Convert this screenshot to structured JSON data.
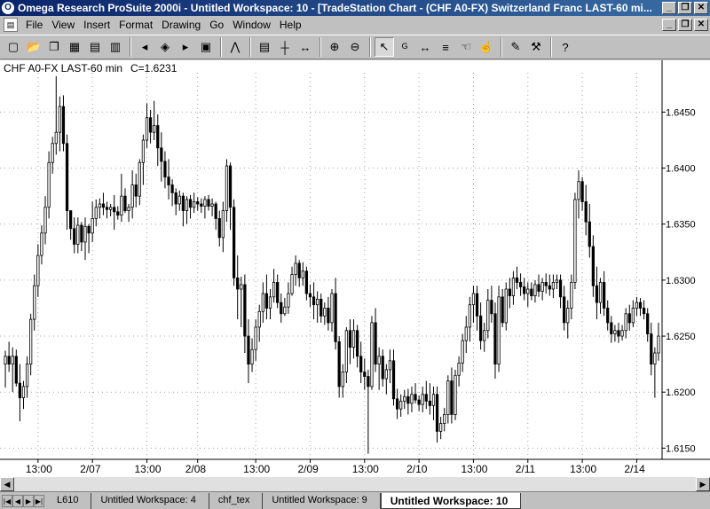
{
  "window": {
    "title": "Omega Research ProSuite 2000i - Untitled Workspace:  10 - [TradeStation Chart - (CHF A0-FX) Switzerland Franc LAST-60 mi...",
    "icon_glyph": "O"
  },
  "menu": {
    "items": [
      "File",
      "View",
      "Insert",
      "Format",
      "Drawing",
      "Go",
      "Window",
      "Help"
    ]
  },
  "toolbar": {
    "buttons": [
      {
        "name": "new-icon",
        "glyph": "▢"
      },
      {
        "name": "open-icon",
        "glyph": "📂"
      },
      {
        "name": "copy-icon",
        "glyph": "❐"
      },
      {
        "name": "grid-icon",
        "glyph": "▦"
      },
      {
        "name": "print-icon",
        "glyph": "▤"
      },
      {
        "name": "printer-icon",
        "glyph": "▥"
      },
      {
        "name": "sep"
      },
      {
        "name": "back-icon",
        "glyph": "◂"
      },
      {
        "name": "send-icon",
        "glyph": "◈"
      },
      {
        "name": "forward-icon",
        "glyph": "▸"
      },
      {
        "name": "chart-icon",
        "glyph": "▣"
      },
      {
        "name": "sep"
      },
      {
        "name": "insert-indicator-icon",
        "glyph": "⋀"
      },
      {
        "name": "sep"
      },
      {
        "name": "format-icon",
        "glyph": "▤"
      },
      {
        "name": "bar-spacing-icon",
        "glyph": "┼"
      },
      {
        "name": "spread-icon",
        "glyph": "↔"
      },
      {
        "name": "sep"
      },
      {
        "name": "zoom-in-icon",
        "glyph": "⊕"
      },
      {
        "name": "zoom-out-icon",
        "glyph": "⊖"
      },
      {
        "name": "sep"
      },
      {
        "name": "pointer-icon",
        "glyph": "↖",
        "pressed": true
      },
      {
        "name": "data-tip-icon",
        "glyph": "ᴳ"
      },
      {
        "name": "horizontal-arrows-icon",
        "glyph": "↔"
      },
      {
        "name": "lines-icon",
        "glyph": "≡"
      },
      {
        "name": "hand-icon",
        "glyph": "☜"
      },
      {
        "name": "hand-alt-icon",
        "glyph": "☝"
      },
      {
        "name": "sep"
      },
      {
        "name": "pencil-icon",
        "glyph": "✎"
      },
      {
        "name": "tools-icon",
        "glyph": "⚒"
      },
      {
        "name": "sep"
      },
      {
        "name": "help-icon",
        "glyph": "?"
      }
    ]
  },
  "chart": {
    "label": "CHF A0-FX LAST-60 min",
    "close_label": "C=1.6231"
  },
  "chart_data": {
    "type": "candlestick",
    "symbol": "CHF A0-FX",
    "interval": "60 min",
    "ylim": [
      1.614,
      1.6482
    ],
    "yticks": [
      "1.6450",
      "1.6400",
      "1.6350",
      "1.6300",
      "1.6250",
      "1.6200",
      "1.6150"
    ],
    "ytick_values": [
      1.645,
      1.64,
      1.635,
      1.63,
      1.625,
      1.62,
      1.615
    ],
    "xticks": [
      {
        "index": 9,
        "label": "13:00"
      },
      {
        "index": 24,
        "label": "2/07"
      },
      {
        "index": 39,
        "label": "13:00"
      },
      {
        "index": 53,
        "label": "2/08"
      },
      {
        "index": 69,
        "label": "13:00"
      },
      {
        "index": 84,
        "label": "2/09"
      },
      {
        "index": 99,
        "label": "13:00"
      },
      {
        "index": 114,
        "label": "2/10"
      },
      {
        "index": 129,
        "label": "13:00"
      },
      {
        "index": 144,
        "label": "2/11"
      },
      {
        "index": 159,
        "label": "13:00"
      },
      {
        "index": 174,
        "label": "2/14"
      }
    ],
    "grid": true,
    "ohlc": [
      [
        1.6225,
        1.6237,
        1.6204,
        1.6232
      ],
      [
        1.6232,
        1.6245,
        1.6218,
        1.6225
      ],
      [
        1.6225,
        1.624,
        1.62,
        1.6232
      ],
      [
        1.6232,
        1.6238,
        1.6205,
        1.6208
      ],
      [
        1.6208,
        1.6225,
        1.6174,
        1.6195
      ],
      [
        1.6195,
        1.621,
        1.6185,
        1.6205
      ],
      [
        1.6205,
        1.6232,
        1.6195,
        1.6225
      ],
      [
        1.6225,
        1.627,
        1.6215,
        1.6265
      ],
      [
        1.6265,
        1.6305,
        1.6255,
        1.6295
      ],
      [
        1.6295,
        1.6332,
        1.6285,
        1.6322
      ],
      [
        1.6322,
        1.6349,
        1.6314,
        1.6342
      ],
      [
        1.6342,
        1.6375,
        1.6332,
        1.6365
      ],
      [
        1.6365,
        1.6415,
        1.6355,
        1.6405
      ],
      [
        1.6405,
        1.6428,
        1.6395,
        1.6422
      ],
      [
        1.6422,
        1.6482,
        1.6412,
        1.6432
      ],
      [
        1.6432,
        1.6464,
        1.6415,
        1.6455
      ],
      [
        1.6455,
        1.6465,
        1.6415,
        1.6422
      ],
      [
        1.6422,
        1.643,
        1.6345,
        1.6362
      ],
      [
        1.6362,
        1.6362,
        1.6336,
        1.6346
      ],
      [
        1.6346,
        1.6356,
        1.6324,
        1.6332
      ],
      [
        1.6332,
        1.6356,
        1.6324,
        1.6349
      ],
      [
        1.6349,
        1.6352,
        1.6326,
        1.6334
      ],
      [
        1.6334,
        1.6356,
        1.6318,
        1.6348
      ],
      [
        1.6348,
        1.635,
        1.6324,
        1.6342
      ],
      [
        1.6342,
        1.637,
        1.6334,
        1.6355
      ],
      [
        1.6355,
        1.6372,
        1.6348,
        1.6365
      ],
      [
        1.6365,
        1.6373,
        1.6355,
        1.6368
      ],
      [
        1.6368,
        1.6378,
        1.6358,
        1.6365
      ],
      [
        1.6365,
        1.637,
        1.6355,
        1.6363
      ],
      [
        1.6363,
        1.6368,
        1.6357,
        1.6365
      ],
      [
        1.6365,
        1.6376,
        1.6345,
        1.6361
      ],
      [
        1.6361,
        1.6366,
        1.6354,
        1.6358
      ],
      [
        1.6358,
        1.6395,
        1.6352,
        1.6375
      ],
      [
        1.6375,
        1.6382,
        1.636,
        1.6362
      ],
      [
        1.6362,
        1.6368,
        1.6352,
        1.6365
      ],
      [
        1.6365,
        1.6398,
        1.6355,
        1.6385
      ],
      [
        1.6385,
        1.6395,
        1.6365,
        1.6375
      ],
      [
        1.6375,
        1.6408,
        1.6367,
        1.6405
      ],
      [
        1.6405,
        1.643,
        1.6385,
        1.6425
      ],
      [
        1.6425,
        1.6458,
        1.6418,
        1.6445
      ],
      [
        1.6445,
        1.6452,
        1.6422,
        1.6432
      ],
      [
        1.6432,
        1.646,
        1.6425,
        1.6438
      ],
      [
        1.6438,
        1.6448,
        1.6402,
        1.6418
      ],
      [
        1.6418,
        1.6432,
        1.6388,
        1.6406
      ],
      [
        1.6406,
        1.6415,
        1.6382,
        1.6392
      ],
      [
        1.6392,
        1.6408,
        1.6372,
        1.6385
      ],
      [
        1.6385,
        1.639,
        1.6366,
        1.6378
      ],
      [
        1.6378,
        1.6382,
        1.6358,
        1.6368
      ],
      [
        1.6368,
        1.638,
        1.6362,
        1.6375
      ],
      [
        1.6375,
        1.6378,
        1.6348,
        1.6362
      ],
      [
        1.6362,
        1.6375,
        1.635,
        1.6372
      ],
      [
        1.6372,
        1.6376,
        1.6355,
        1.6365
      ],
      [
        1.6365,
        1.6378,
        1.636,
        1.637
      ],
      [
        1.637,
        1.6374,
        1.6362,
        1.6368
      ],
      [
        1.6368,
        1.6373,
        1.636,
        1.6366
      ],
      [
        1.6366,
        1.6375,
        1.6355,
        1.6372
      ],
      [
        1.6372,
        1.6376,
        1.6362,
        1.6366
      ],
      [
        1.6366,
        1.6373,
        1.6357,
        1.6368
      ],
      [
        1.6368,
        1.637,
        1.6345,
        1.6355
      ],
      [
        1.6355,
        1.6362,
        1.633,
        1.6338
      ],
      [
        1.6338,
        1.637,
        1.6325,
        1.6362
      ],
      [
        1.6362,
        1.6408,
        1.6352,
        1.6402
      ],
      [
        1.6402,
        1.6405,
        1.6345,
        1.6365
      ],
      [
        1.6365,
        1.6372,
        1.6295,
        1.6302
      ],
      [
        1.6302,
        1.6322,
        1.6265,
        1.6292
      ],
      [
        1.6292,
        1.6303,
        1.6258,
        1.6296
      ],
      [
        1.6296,
        1.6305,
        1.6235,
        1.625
      ],
      [
        1.625,
        1.6265,
        1.6208,
        1.6225
      ],
      [
        1.6225,
        1.6248,
        1.6218,
        1.6238
      ],
      [
        1.6238,
        1.6265,
        1.6228,
        1.6258
      ],
      [
        1.6258,
        1.6278,
        1.6245,
        1.6272
      ],
      [
        1.6272,
        1.6298,
        1.6262,
        1.6288
      ],
      [
        1.6288,
        1.6305,
        1.6265,
        1.6275
      ],
      [
        1.6275,
        1.6292,
        1.6265,
        1.6285
      ],
      [
        1.6285,
        1.631,
        1.628,
        1.6298
      ],
      [
        1.6298,
        1.6305,
        1.6275,
        1.628
      ],
      [
        1.628,
        1.6288,
        1.6262,
        1.627
      ],
      [
        1.627,
        1.6284,
        1.6268,
        1.6276
      ],
      [
        1.6276,
        1.6298,
        1.627,
        1.6288
      ],
      [
        1.6288,
        1.6312,
        1.6286,
        1.6305
      ],
      [
        1.6305,
        1.6322,
        1.6295,
        1.6315
      ],
      [
        1.6315,
        1.6318,
        1.6294,
        1.6302
      ],
      [
        1.6302,
        1.6316,
        1.6295,
        1.6308
      ],
      [
        1.6308,
        1.6312,
        1.6282,
        1.6288
      ],
      [
        1.6288,
        1.6296,
        1.6276,
        1.6285
      ],
      [
        1.6285,
        1.6298,
        1.6265,
        1.6278
      ],
      [
        1.6278,
        1.629,
        1.6262,
        1.6283
      ],
      [
        1.6283,
        1.6288,
        1.6262,
        1.6268
      ],
      [
        1.6268,
        1.628,
        1.626,
        1.6275
      ],
      [
        1.6275,
        1.6285,
        1.6255,
        1.6262
      ],
      [
        1.6262,
        1.6292,
        1.6254,
        1.6288
      ],
      [
        1.6288,
        1.6302,
        1.6238,
        1.6245
      ],
      [
        1.6245,
        1.625,
        1.6195,
        1.6205
      ],
      [
        1.6205,
        1.6225,
        1.6195,
        1.6218
      ],
      [
        1.6218,
        1.6258,
        1.6208,
        1.6255
      ],
      [
        1.6255,
        1.6265,
        1.6225,
        1.624
      ],
      [
        1.624,
        1.6265,
        1.623,
        1.6255
      ],
      [
        1.6255,
        1.626,
        1.6222,
        1.6232
      ],
      [
        1.6232,
        1.6245,
        1.6208,
        1.6218
      ],
      [
        1.6218,
        1.623,
        1.6202,
        1.6214
      ],
      [
        1.6214,
        1.622,
        1.6145,
        1.6205
      ],
      [
        1.6205,
        1.6268,
        1.6202,
        1.6262
      ],
      [
        1.6262,
        1.6275,
        1.6218,
        1.6225
      ],
      [
        1.6225,
        1.624,
        1.6202,
        1.6232
      ],
      [
        1.6232,
        1.6238,
        1.6205,
        1.6212
      ],
      [
        1.6212,
        1.6225,
        1.6198,
        1.622
      ],
      [
        1.622,
        1.6238,
        1.6208,
        1.6228
      ],
      [
        1.6228,
        1.6238,
        1.6188,
        1.6194
      ],
      [
        1.6194,
        1.6203,
        1.6176,
        1.6185
      ],
      [
        1.6185,
        1.6198,
        1.6178,
        1.6192
      ],
      [
        1.6192,
        1.6202,
        1.6185,
        1.6196
      ],
      [
        1.6196,
        1.6203,
        1.618,
        1.619
      ],
      [
        1.619,
        1.6205,
        1.6182,
        1.6198
      ],
      [
        1.6198,
        1.6208,
        1.619,
        1.6193
      ],
      [
        1.6193,
        1.6197,
        1.6183,
        1.6189
      ],
      [
        1.6189,
        1.6205,
        1.6182,
        1.6198
      ],
      [
        1.6198,
        1.621,
        1.6185,
        1.6192
      ],
      [
        1.6192,
        1.6208,
        1.618,
        1.6188
      ],
      [
        1.6188,
        1.6205,
        1.6175,
        1.6198
      ],
      [
        1.6198,
        1.6205,
        1.6155,
        1.6165
      ],
      [
        1.6165,
        1.6178,
        1.6158,
        1.6172
      ],
      [
        1.6172,
        1.6186,
        1.6165,
        1.618
      ],
      [
        1.618,
        1.6215,
        1.6172,
        1.621
      ],
      [
        1.621,
        1.6222,
        1.6172,
        1.618
      ],
      [
        1.618,
        1.622,
        1.6175,
        1.6215
      ],
      [
        1.6215,
        1.6232,
        1.6205,
        1.6226
      ],
      [
        1.6226,
        1.6252,
        1.6218,
        1.6246
      ],
      [
        1.6246,
        1.6268,
        1.6235,
        1.6258
      ],
      [
        1.6258,
        1.6285,
        1.6245,
        1.6278
      ],
      [
        1.6278,
        1.6295,
        1.6262,
        1.6288
      ],
      [
        1.6288,
        1.6295,
        1.6255,
        1.6268
      ],
      [
        1.6268,
        1.628,
        1.6238,
        1.6246
      ],
      [
        1.6246,
        1.6262,
        1.6236,
        1.6255
      ],
      [
        1.6255,
        1.6292,
        1.6248,
        1.6282
      ],
      [
        1.6282,
        1.6295,
        1.6262,
        1.627
      ],
      [
        1.627,
        1.628,
        1.6212,
        1.6225
      ],
      [
        1.6225,
        1.6295,
        1.6218,
        1.6285
      ],
      [
        1.6285,
        1.6292,
        1.6258,
        1.6262
      ],
      [
        1.6262,
        1.6298,
        1.6255,
        1.6292
      ],
      [
        1.6292,
        1.6302,
        1.6275,
        1.6286
      ],
      [
        1.6286,
        1.6308,
        1.6278,
        1.6302
      ],
      [
        1.6302,
        1.6312,
        1.6292,
        1.6298
      ],
      [
        1.6298,
        1.6306,
        1.6286,
        1.6294
      ],
      [
        1.6294,
        1.6302,
        1.6282,
        1.6288
      ],
      [
        1.6288,
        1.6298,
        1.6276,
        1.6292
      ],
      [
        1.6292,
        1.6298,
        1.6282,
        1.6286
      ],
      [
        1.6286,
        1.63,
        1.628,
        1.6296
      ],
      [
        1.6296,
        1.6305,
        1.6285,
        1.629
      ],
      [
        1.629,
        1.6302,
        1.6282,
        1.6298
      ],
      [
        1.6298,
        1.6306,
        1.6288,
        1.6295
      ],
      [
        1.6295,
        1.6305,
        1.6286,
        1.6292
      ],
      [
        1.6292,
        1.6305,
        1.6284,
        1.6298
      ],
      [
        1.6298,
        1.6305,
        1.6292,
        1.63
      ],
      [
        1.63,
        1.6305,
        1.6275,
        1.6285
      ],
      [
        1.6285,
        1.6295,
        1.6255,
        1.6262
      ],
      [
        1.6262,
        1.6282,
        1.6248,
        1.6275
      ],
      [
        1.6275,
        1.6305,
        1.6265,
        1.6298
      ],
      [
        1.6298,
        1.6378,
        1.6292,
        1.6372
      ],
      [
        1.6372,
        1.6398,
        1.6355,
        1.6388
      ],
      [
        1.6388,
        1.6392,
        1.6362,
        1.637
      ],
      [
        1.637,
        1.6385,
        1.634,
        1.6352
      ],
      [
        1.6352,
        1.6368,
        1.632,
        1.633
      ],
      [
        1.633,
        1.634,
        1.6285,
        1.6295
      ],
      [
        1.6295,
        1.6312,
        1.6265,
        1.628
      ],
      [
        1.628,
        1.6302,
        1.627,
        1.6298
      ],
      [
        1.6298,
        1.6308,
        1.6268,
        1.6275
      ],
      [
        1.6275,
        1.6282,
        1.6255,
        1.6262
      ],
      [
        1.6262,
        1.6268,
        1.6244,
        1.6252
      ],
      [
        1.6252,
        1.626,
        1.6245,
        1.6255
      ],
      [
        1.6255,
        1.6262,
        1.6244,
        1.625
      ],
      [
        1.625,
        1.626,
        1.6246,
        1.6255
      ],
      [
        1.6255,
        1.6275,
        1.6248,
        1.627
      ],
      [
        1.627,
        1.6278,
        1.6255,
        1.6262
      ],
      [
        1.6262,
        1.6282,
        1.6258,
        1.6275
      ],
      [
        1.6275,
        1.6285,
        1.6268,
        1.628
      ],
      [
        1.628,
        1.6284,
        1.6268,
        1.6275
      ],
      [
        1.6275,
        1.6282,
        1.6265,
        1.627
      ],
      [
        1.627,
        1.6275,
        1.6245,
        1.6252
      ],
      [
        1.6252,
        1.6262,
        1.6215,
        1.6225
      ],
      [
        1.6225,
        1.624,
        1.6195,
        1.6235
      ],
      [
        1.6235,
        1.6262,
        1.6228,
        1.625
      ]
    ]
  },
  "scrollbar": {
    "left": "◀",
    "right": "▶"
  },
  "tabs": {
    "nav": [
      "|◀",
      "◀",
      "▶",
      "▶|"
    ],
    "items": [
      {
        "label": "L610",
        "active": false
      },
      {
        "label": "Untitled Workspace:  4",
        "active": false
      },
      {
        "label": "chf_tex",
        "active": false
      },
      {
        "label": "Untitled Workspace:  9",
        "active": false
      },
      {
        "label": "Untitled Workspace:  10",
        "active": true
      }
    ]
  }
}
